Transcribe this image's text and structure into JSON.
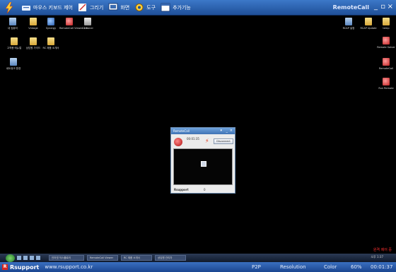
{
  "toolbar": {
    "items": [
      "마우스 키보드 제어",
      "그리기",
      "화면",
      "도구",
      "추가기능"
    ],
    "title": "RemoteCall",
    "minimize": "_",
    "restore": "▫",
    "close": "×"
  },
  "desktop": {
    "left_icons": [
      {
        "label": "내 컴퓨터",
        "icon": "computer-icon"
      },
      {
        "label": "Vintage",
        "icon": "folder-icon"
      },
      {
        "label": "Synergy",
        "icon": "synergy-icon"
      },
      {
        "label": "RemoteCall Viewer 4.0",
        "icon": "remotecall-icon"
      },
      {
        "label": "CCleaner",
        "icon": "ccleaner-icon"
      },
      {
        "label": "고객용 매뉴얼",
        "icon": "folder-icon"
      },
      {
        "label": "상담원 가이드",
        "icon": "folder-icon"
      },
      {
        "label": "RC 제품 소개서",
        "icon": "folder-icon"
      },
      {
        "label": "네트워크 환경",
        "icon": "network-icon"
      }
    ],
    "right_icons": [
      {
        "label": "RCAP 설정",
        "icon": "rcap-icon"
      },
      {
        "label": "RCAP Update",
        "icon": "folder-icon"
      },
      {
        "label": "temp",
        "icon": "folder-icon"
      },
      {
        "label": "Remote Solver",
        "icon": "remote-solver-icon"
      },
      {
        "label": "RemoteCall",
        "icon": "remotecall-icon"
      },
      {
        "label": "Run Remote",
        "icon": "run-remote-icon"
      }
    ]
  },
  "remote_window": {
    "title": "RemoteCall",
    "time": "00:01:35",
    "disconnect_label": "Disconnect",
    "footer_brand": "Rsupport",
    "footer_value": "0"
  },
  "taskbar": {
    "tasks": [
      "인터넷 익스플로러",
      "RemoteCall Viewer",
      "RC 제품 소개서",
      "상담원 관리자"
    ],
    "tray_time": "오후 1:37",
    "overlay_text": "원격 제어 중"
  },
  "statusbar": {
    "brand": "Rsupport",
    "url": "www.rsupport.co.kr",
    "mode": "P2P",
    "resolution_label": "Resolution",
    "color_label": "Color",
    "quality": "60%",
    "elapsed": "00:01:37"
  }
}
